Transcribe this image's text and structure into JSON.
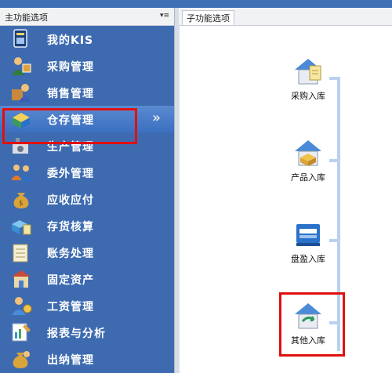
{
  "left_panel": {
    "title": "主功能选项",
    "pin": "▾≡",
    "items": [
      {
        "label": "我的KIS",
        "icon": "kis-card-icon"
      },
      {
        "label": "采购管理",
        "icon": "purchase-icon"
      },
      {
        "label": "销售管理",
        "icon": "sales-icon"
      },
      {
        "label": "仓存管理",
        "icon": "warehouse-icon",
        "selected": true,
        "arrow": "»"
      },
      {
        "label": "生产管理",
        "icon": "production-icon"
      },
      {
        "label": "委外管理",
        "icon": "outsource-icon"
      },
      {
        "label": "应收应付",
        "icon": "money-bag-icon"
      },
      {
        "label": "存货核算",
        "icon": "inventory-icon"
      },
      {
        "label": "账务处理",
        "icon": "ledger-icon"
      },
      {
        "label": "固定资产",
        "icon": "asset-icon"
      },
      {
        "label": "工资管理",
        "icon": "salary-icon"
      },
      {
        "label": "报表与分析",
        "icon": "report-icon"
      },
      {
        "label": "出纳管理",
        "icon": "cashier-icon"
      }
    ]
  },
  "right_panel": {
    "tab": "子功能选项",
    "items": [
      {
        "label": "采购入库",
        "icon": "purchase-inbound-icon"
      },
      {
        "label": "产品入库",
        "icon": "product-inbound-icon"
      },
      {
        "label": "盘盈入库",
        "icon": "inventory-surplus-icon"
      },
      {
        "label": "其他入库",
        "icon": "other-inbound-icon"
      }
    ]
  },
  "colors": {
    "panel_blue": "#3e6bb0",
    "selection_red": "#e01010",
    "flow_line": "#b9d1ee"
  }
}
